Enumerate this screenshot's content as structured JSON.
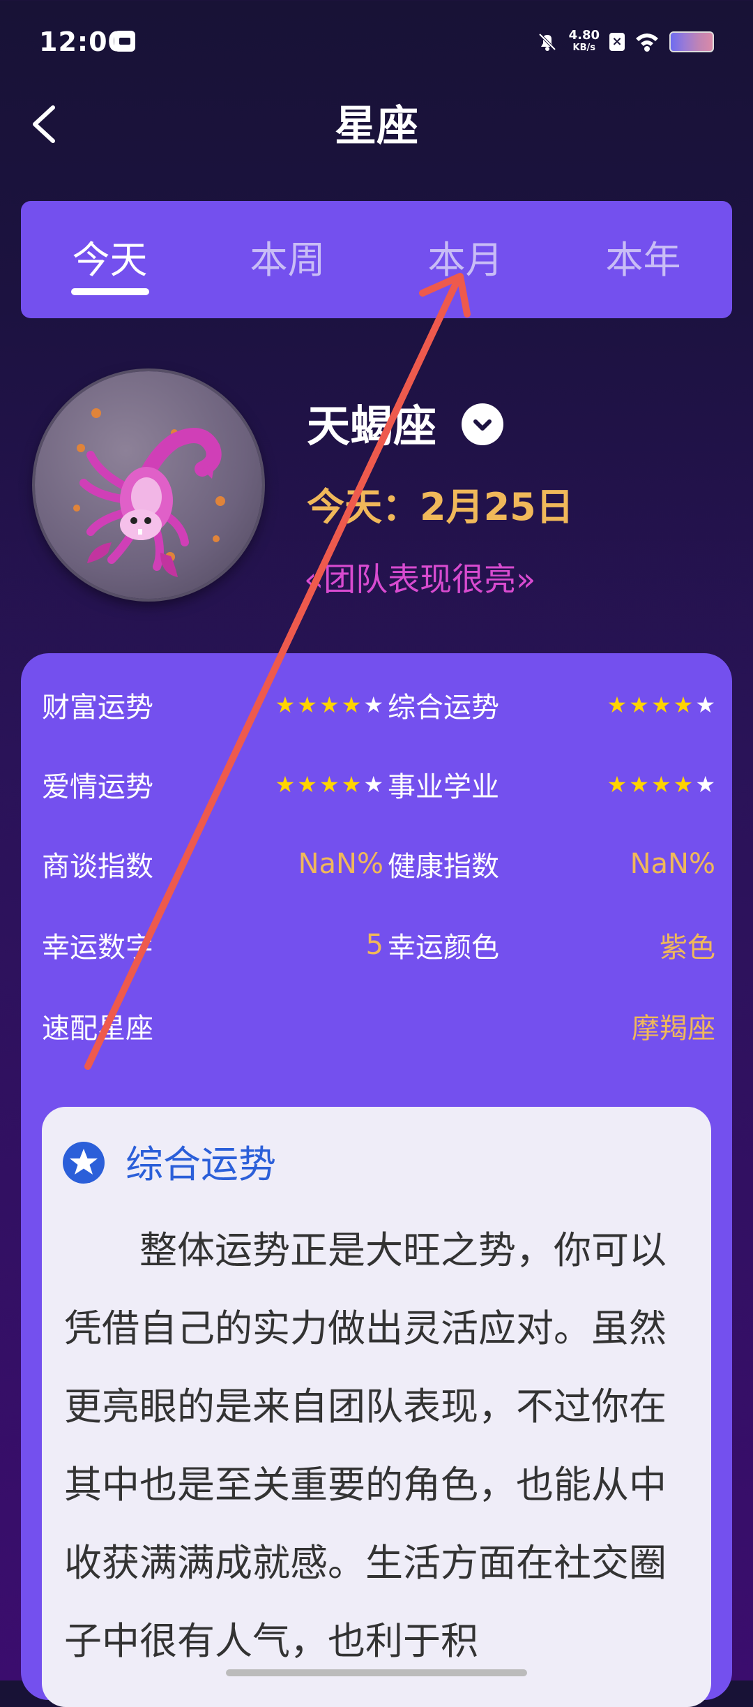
{
  "status_bar": {
    "time": "12:00",
    "net_speed_value": "4.80",
    "net_speed_unit": "KB/s"
  },
  "header": {
    "title": "星座"
  },
  "tabs": [
    {
      "label": "今天",
      "active": true
    },
    {
      "label": "本周",
      "active": false
    },
    {
      "label": "本月",
      "active": false
    },
    {
      "label": "本年",
      "active": false
    }
  ],
  "sign": {
    "name": "天蝎座",
    "date": "今天：2月25日",
    "motto": "«团队表现很亮»"
  },
  "fortunes": {
    "wealth": {
      "label": "财富运势",
      "stars": 4,
      "max": 5
    },
    "overall": {
      "label": "综合运势",
      "stars": 4,
      "max": 5
    },
    "love": {
      "label": "爱情运势",
      "stars": 4,
      "max": 5
    },
    "career": {
      "label": "事业学业",
      "stars": 4,
      "max": 5
    },
    "negotiation": {
      "label": "商谈指数",
      "value": "NaN%"
    },
    "health": {
      "label": "健康指数",
      "value": "NaN%"
    },
    "lucky_number": {
      "label": "幸运数字",
      "value": "5"
    },
    "lucky_color": {
      "label": "幸运颜色",
      "value": "紫色"
    },
    "match": {
      "label": "速配星座",
      "value": "摩羯座"
    }
  },
  "detail": {
    "heading": "综合运势",
    "text": "整体运势正是大旺之势，你可以凭借自己的实力做出灵活应对。虽然更亮眼的是来自团队表现，不过你在其中也是至关重要的角色，也能从中收获满满成就感。生活方面在社交圈子中很有人气，也利于积"
  },
  "colors": {
    "accent": "#7450ee",
    "gold": "#f0b85a",
    "motto": "#d84bd0",
    "link_blue": "#2b5fd9",
    "annotation_arrow": "#ee5a4d"
  }
}
